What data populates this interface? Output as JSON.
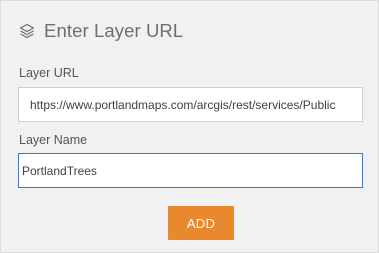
{
  "dialog": {
    "title": "Enter Layer URL",
    "header_icon": "layers-icon"
  },
  "layer_url": {
    "label": "Layer URL",
    "value": "https://www.portlandmaps.com/arcgis/rest/services/Public"
  },
  "layer_name": {
    "label": "Layer Name",
    "value": "PortlandTrees"
  },
  "actions": {
    "add_label": "ADD"
  },
  "colors": {
    "panel_background": "#f1f1f1",
    "accent": "#e8892e",
    "focus_border": "#4a76b8",
    "title_text": "#6e6e6e"
  }
}
